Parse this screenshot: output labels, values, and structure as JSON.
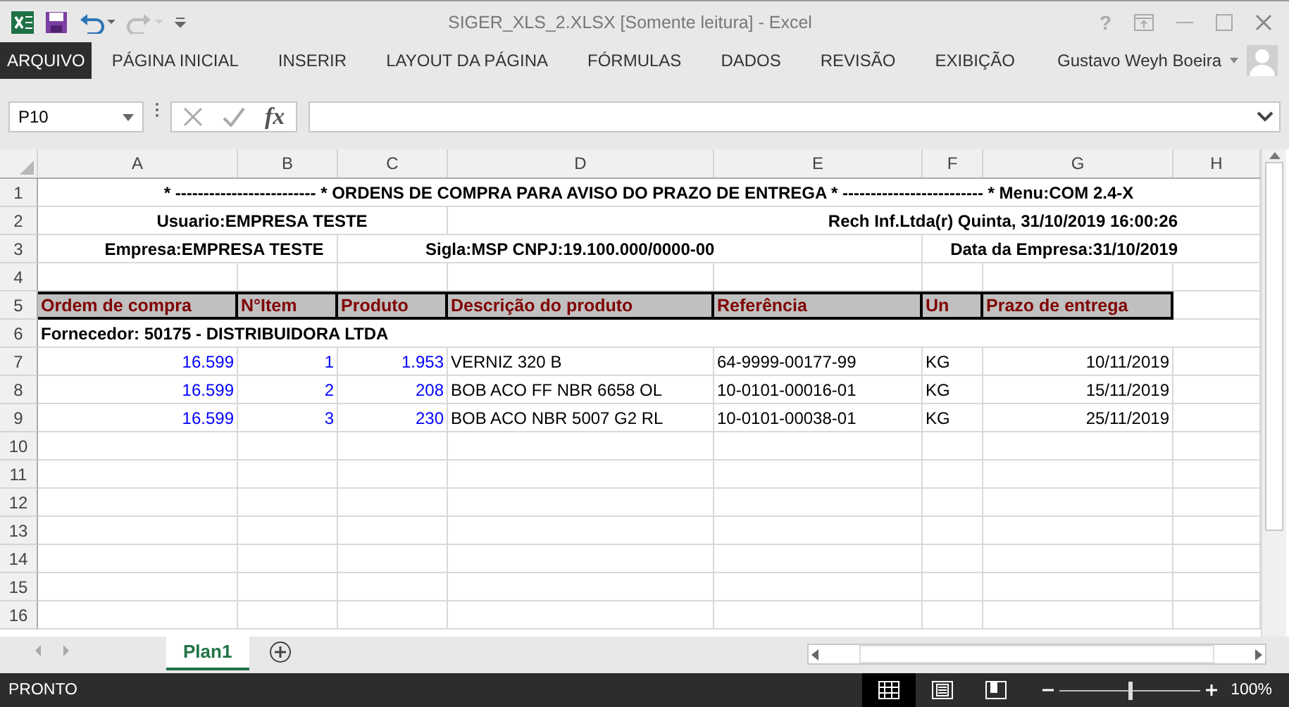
{
  "window": {
    "title": "SIGER_XLS_2.XLSX  [Somente leitura] - Excel",
    "help": "?"
  },
  "ribbon": {
    "tabs": [
      {
        "label": "ARQUIVO",
        "kind": "file"
      },
      {
        "label": "PÁGINA INICIAL",
        "kind": "tab"
      },
      {
        "label": "INSERIR",
        "kind": "tab"
      },
      {
        "label": "LAYOUT DA PÁGINA",
        "kind": "tab"
      },
      {
        "label": "FÓRMULAS",
        "kind": "tab"
      },
      {
        "label": "DADOS",
        "kind": "tab"
      },
      {
        "label": "REVISÃO",
        "kind": "tab"
      },
      {
        "label": "EXIBIÇÃO",
        "kind": "tab"
      }
    ],
    "user": "Gustavo Weyh Boeira"
  },
  "formula_bar": {
    "name_box": "P10",
    "function_label": "fx"
  },
  "sheet": {
    "columns": [
      "A",
      "B",
      "C",
      "D",
      "E",
      "F",
      "G",
      "H"
    ],
    "rows": [
      {
        "number": "1",
        "kind": "title",
        "texts": [
          "* ------------------------- * ORDENS DE COMPRA PARA AVISO DO PRAZO DE ENTREGA * ------------------------- * Menu:COM 2.4-X"
        ]
      },
      {
        "number": "2",
        "kind": "info",
        "texts": [
          "Usuario:EMPRESA TESTE",
          "Rech Inf.Ltda(r)   Quinta, 31/10/2019 16:00:26"
        ]
      },
      {
        "number": "3",
        "kind": "info",
        "texts": [
          "Empresa:EMPRESA TESTE",
          "Sigla:MSP   CNPJ:19.100.000/0000-00",
          "Data da Empresa:31/10/2019"
        ]
      },
      {
        "number": "4",
        "kind": "empty"
      },
      {
        "number": "5",
        "kind": "header",
        "texts": [
          "Ordem de compra",
          "N°Item",
          "Produto",
          "Descrição do produto",
          "Referência",
          "Un",
          "Prazo de entrega"
        ]
      },
      {
        "number": "6",
        "kind": "group",
        "texts": [
          "Fornecedor:   50175 - DISTRIBUIDORA LTDA"
        ]
      },
      {
        "number": "7",
        "kind": "data",
        "texts": [
          "16.599",
          "1",
          "1.953",
          "VERNIZ 320 B",
          "64-9999-00177-99",
          "KG",
          "10/11/2019"
        ]
      },
      {
        "number": "8",
        "kind": "data",
        "texts": [
          "16.599",
          "2",
          "208",
          "BOB ACO FF NBR 6658 OL",
          "10-0101-00016-01",
          "KG",
          "15/11/2019"
        ]
      },
      {
        "number": "9",
        "kind": "data",
        "texts": [
          "16.599",
          "3",
          "230",
          "BOB ACO NBR 5007 G2 RL",
          "10-0101-00038-01",
          "KG",
          "25/11/2019"
        ]
      },
      {
        "number": "10",
        "kind": "empty"
      },
      {
        "number": "11",
        "kind": "empty"
      },
      {
        "number": "12",
        "kind": "empty"
      },
      {
        "number": "13",
        "kind": "empty"
      },
      {
        "number": "14",
        "kind": "empty"
      },
      {
        "number": "15",
        "kind": "empty"
      },
      {
        "number": "16",
        "kind": "empty"
      }
    ]
  },
  "sheet_tabs": [
    {
      "label": "Plan1",
      "selected": true
    }
  ],
  "status_bar": {
    "status": "PRONTO",
    "views": [
      {
        "kind": "normal",
        "selected": true
      },
      {
        "kind": "page-layout",
        "selected": false
      },
      {
        "kind": "page-break",
        "selected": false
      }
    ],
    "zoom": {
      "level": 0.5,
      "reading": "100%"
    }
  }
}
